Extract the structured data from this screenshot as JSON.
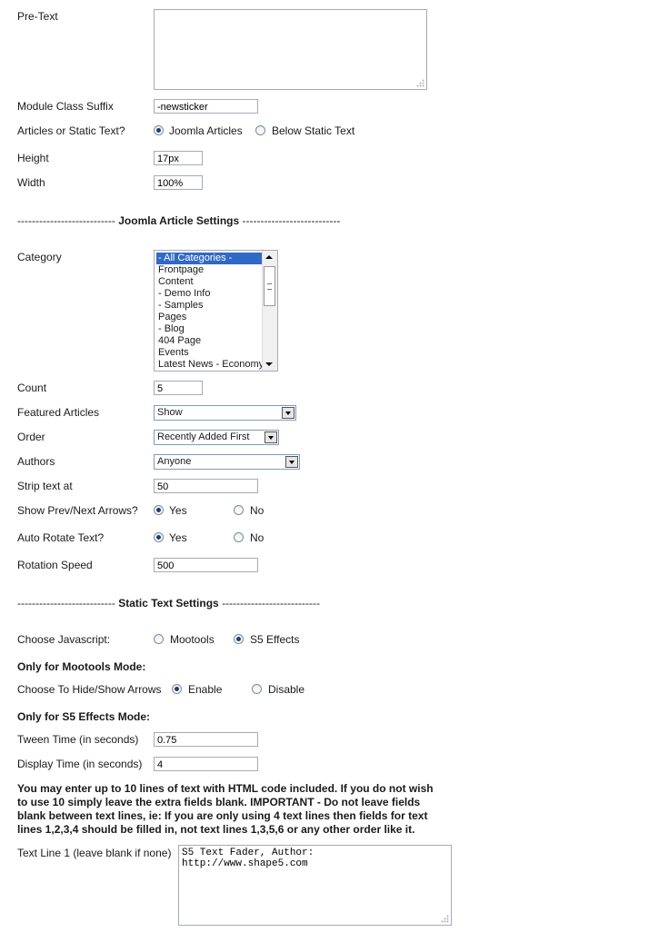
{
  "pretext": {
    "label": "Pre-Text",
    "value": ""
  },
  "module_class_suffix": {
    "label": "Module Class Suffix",
    "value": "-newsticker"
  },
  "articles_or_static": {
    "label": "Articles or Static Text?",
    "option1": "Joomla Articles",
    "option2": "Below Static Text",
    "selected": "Joomla Articles"
  },
  "height": {
    "label": "Height",
    "value": "17px"
  },
  "width": {
    "label": "Width",
    "value": "100%"
  },
  "joomla_section": {
    "dashes_left": "---------------------------",
    "title": "Joomla Article Settings",
    "dashes_right": "---------------------------"
  },
  "category": {
    "label": "Category",
    "options": [
      "- All Categories -",
      "Frontpage",
      "Content",
      "- Demo Info",
      "- Samples",
      "Pages",
      "- Blog",
      "404 Page",
      "Events",
      "Latest News - Economy"
    ],
    "selected": "- All Categories -"
  },
  "count": {
    "label": "Count",
    "value": "5"
  },
  "featured": {
    "label": "Featured Articles",
    "value": "Show"
  },
  "order": {
    "label": "Order",
    "value": "Recently Added First"
  },
  "authors": {
    "label": "Authors",
    "value": "Anyone"
  },
  "strip": {
    "label": "Strip text at",
    "value": "50"
  },
  "prevnext": {
    "label": "Show Prev/Next Arrows?",
    "yes": "Yes",
    "no": "No",
    "selected": "Yes"
  },
  "autorotate": {
    "label": "Auto Rotate Text?",
    "yes": "Yes",
    "no": "No",
    "selected": "Yes"
  },
  "rotation_speed": {
    "label": "Rotation Speed",
    "value": "500"
  },
  "static_section": {
    "dashes_left": "---------------------------",
    "title": "Static Text Settings",
    "dashes_right": "---------------------------"
  },
  "javascript": {
    "label": "Choose Javascript:",
    "option1": "Mootools",
    "option2": "S5 Effects",
    "selected": "S5 Effects"
  },
  "mootools_heading": "Only for Mootools Mode:",
  "hide_show": {
    "label": "Choose To Hide/Show Arrows",
    "option1": "Enable",
    "option2": "Disable",
    "selected": "Enable"
  },
  "s5_heading": "Only for S5 Effects Mode:",
  "tween": {
    "label": "Tween Time (in seconds)",
    "value": "0.75"
  },
  "display": {
    "label": "Display Time (in seconds)",
    "value": "4"
  },
  "instructions": "You may enter up to 10 lines of text with HTML code included. If you do not wish to use 10 simply leave the extra fields blank. IMPORTANT - Do not leave fields blank between text lines, ie: If you are only using 4 text lines then fields for text lines 1,2,3,4 should be filled in, not text lines 1,3,5,6 or any other order like it.",
  "text_line_1": {
    "label": "Text Line 1 (leave blank if none)",
    "value": "S5 Text Fader, Author:\nhttp://www.shape5.com"
  }
}
